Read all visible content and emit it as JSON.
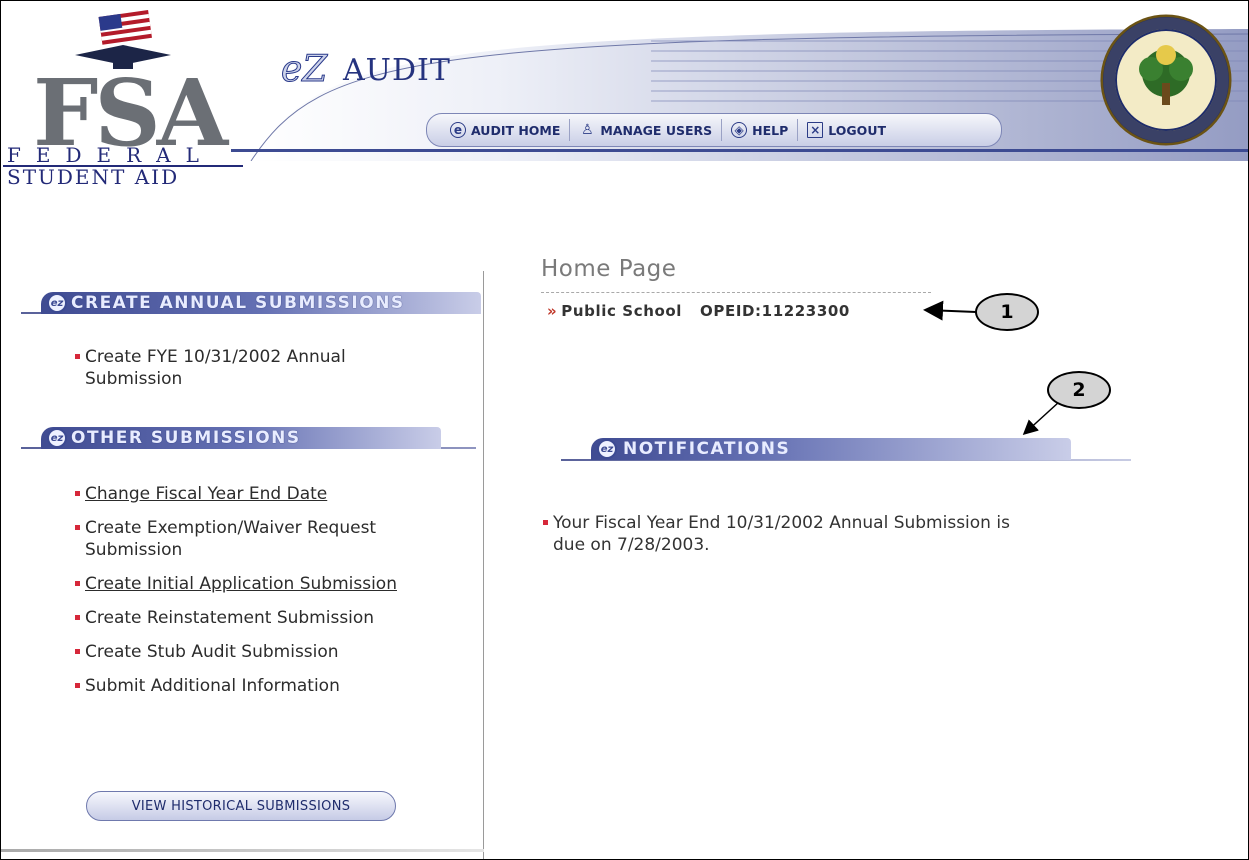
{
  "brand": {
    "fsa_letters": "FSA",
    "federal": "FEDERAL",
    "student_aid": "STUDENT AID",
    "app_title": "AUDIT",
    "app_prefix": "eZ"
  },
  "topnav": [
    {
      "label": "AUDIT HOME",
      "icon": "ez-icon"
    },
    {
      "label": "MANAGE USERS",
      "icon": "users-icon"
    },
    {
      "label": "HELP",
      "icon": "help-icon"
    },
    {
      "label": "LOGOUT",
      "icon": "logout-icon"
    }
  ],
  "sidebar": {
    "annual_heading": "CREATE ANNUAL SUBMISSIONS",
    "annual_items": [
      {
        "label": "Create FYE 10/31/2002 Annual Submission",
        "underlined": false
      }
    ],
    "other_heading": "OTHER SUBMISSIONS",
    "other_items": [
      {
        "label": "Change Fiscal Year End Date",
        "underlined": true
      },
      {
        "label": "Create Exemption/Waiver Request Submission",
        "underlined": false
      },
      {
        "label": "Create Initial Application Submission",
        "underlined": true
      },
      {
        "label": "Create Reinstatement Submission",
        "underlined": false
      },
      {
        "label": "Create Stub Audit Submission",
        "underlined": false
      },
      {
        "label": "Submit Additional Information",
        "underlined": false
      }
    ],
    "history_button": "VIEW HISTORICAL SUBMISSIONS"
  },
  "main": {
    "page_title": "Home Page",
    "school_name": "Public School",
    "opeid": "OPEID:11223300",
    "notifications_heading": "NOTIFICATIONS",
    "notification_text": "Your Fiscal Year End 10/31/2002 Annual Submission is due on 7/28/2003."
  },
  "callouts": [
    "1",
    "2"
  ],
  "colors": {
    "navy": "#25337f",
    "bullet_red": "#d6283a",
    "header_gradient": "#3f4b92"
  }
}
